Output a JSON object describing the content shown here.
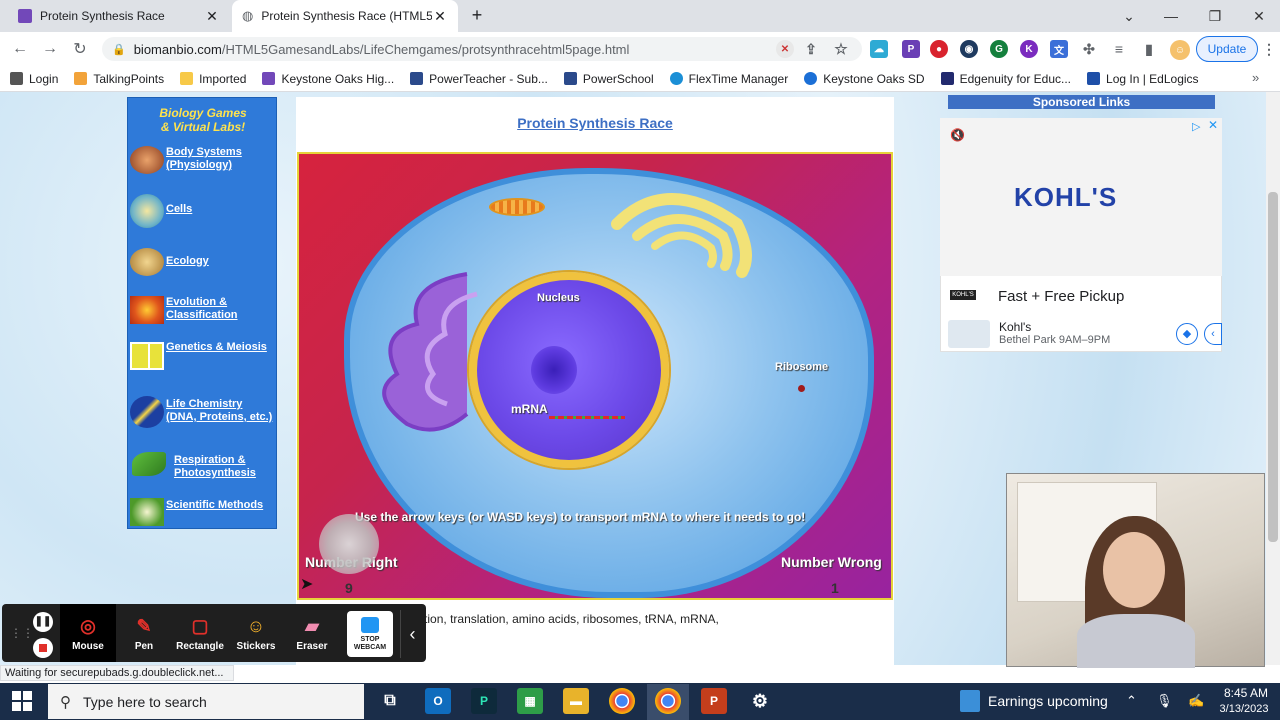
{
  "browser": {
    "tabs": [
      {
        "title": "Protein Synthesis Race",
        "active": false
      },
      {
        "title": "Protein Synthesis Race (HTML5)",
        "active": true
      }
    ],
    "new_tab": "+",
    "address_host": "biomanbio.com",
    "address_path": "/HTML5GamesandLabs/LifeChemgames/protsynthracehtml5page.html",
    "update_label": "Update",
    "bookmarks": [
      "Login",
      "TalkingPoints",
      "Imported",
      "Keystone Oaks Hig...",
      "PowerTeacher - Sub...",
      "PowerSchool",
      "FlexTime Manager",
      "Keystone Oaks SD",
      "Edgenuity for Educ...",
      "Log In | EdLogics"
    ],
    "status": "Waiting for securepubads.g.doubleclick.net..."
  },
  "sidebar": {
    "title_line1": "Biology Games",
    "title_line2": "& Virtual Labs!",
    "items": [
      {
        "line1": "Body Systems",
        "line2": "(Physiology)"
      },
      {
        "line1": "Cells",
        "line2": ""
      },
      {
        "line1": "Ecology",
        "line2": ""
      },
      {
        "line1": "Evolution &",
        "line2": "Classification"
      },
      {
        "line1": "Genetics & Meiosis",
        "line2": ""
      },
      {
        "line1": "Life Chemistry",
        "line2": "(DNA, Proteins, etc.)"
      },
      {
        "line1": "Respiration &",
        "line2": "Photosynthesis"
      },
      {
        "line1": "Scientific Methods",
        "line2": ""
      }
    ]
  },
  "game": {
    "title": "Protein Synthesis Race",
    "nucleus_label": "Nucleus",
    "mrna_label": "mRNA",
    "ribosome_label": "Ribosome",
    "instruction": "Use the arrow keys (or WASD keys) to transport mRNA to where it needs to go!",
    "right_label": "Number Right",
    "right_value": "9",
    "wrong_label": "Number Wrong",
    "wrong_value": "1"
  },
  "below_text": "ein synthesis, transcription, translation, amino acids, ribosomes, tRNA, mRNA,",
  "ad": {
    "header": "Sponsored Links",
    "brand": "KOHL'S",
    "headline": "Fast + Free Pickup",
    "store": "Kohl's",
    "location": "Bethel Park 9AM–9PM"
  },
  "draw_toolbar": {
    "tools": [
      "Mouse",
      "Pen",
      "Rectangle",
      "Stickers",
      "Eraser"
    ],
    "stop_line1": "STOP",
    "stop_line2": "WEBCAM"
  },
  "taskbar": {
    "search_placeholder": "Type here to search",
    "news": "Earnings upcoming",
    "time": "8:45 AM",
    "date": "3/13/2023"
  }
}
